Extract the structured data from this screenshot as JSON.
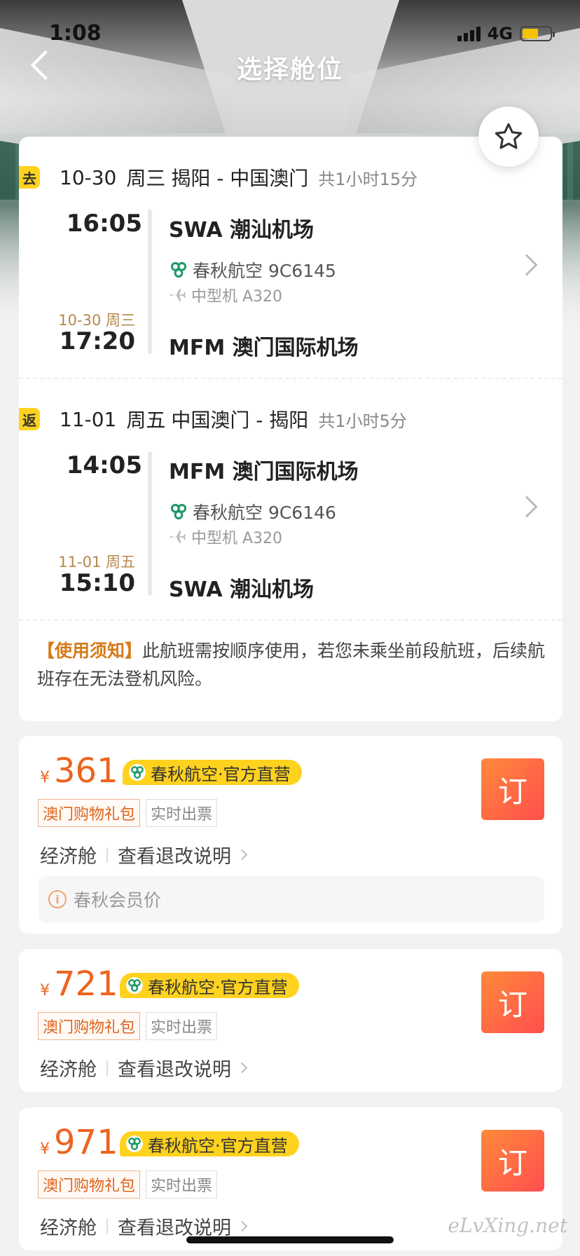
{
  "status_bar": {
    "time": "1:08",
    "network": "4G"
  },
  "nav": {
    "title": "选择舱位"
  },
  "segments": [
    {
      "tag": "去",
      "date": "10-30",
      "weekday": "周三",
      "route": "揭阳 - 中国澳门",
      "duration": "共1小时15分",
      "dep_time": "16:05",
      "dep_airport": "SWA 潮汕机场",
      "airline_flight": "春秋航空 9C6145",
      "aircraft": "中型机 A320",
      "arr_date": "10-30 周三",
      "arr_time": "17:20",
      "arr_airport": "MFM 澳门国际机场"
    },
    {
      "tag": "返",
      "date": "11-01",
      "weekday": "周五",
      "route": "中国澳门 - 揭阳",
      "duration": "共1小时5分",
      "dep_time": "14:05",
      "dep_airport": "MFM 澳门国际机场",
      "airline_flight": "春秋航空 9C6146",
      "aircraft": "中型机 A320",
      "arr_date": "11-01 周五",
      "arr_time": "15:10",
      "arr_airport": "SWA 潮汕机场"
    }
  ],
  "notice": {
    "highlight": "【使用须知】",
    "text": "此航班需按顺序使用，若您未乘坐前段航班，后续航班存在无法登机风险。"
  },
  "offers": [
    {
      "currency": "¥",
      "price": "361",
      "airline_badge": "春秋航空·官方直营",
      "tag1": "澳门购物礼包",
      "tag2": "实时出票",
      "cabin": "经济舱",
      "rules": "查看退改说明",
      "book": "订",
      "member": "春秋会员价"
    },
    {
      "currency": "¥",
      "price": "721",
      "airline_badge": "春秋航空·官方直营",
      "tag1": "澳门购物礼包",
      "tag2": "实时出票",
      "cabin": "经济舱",
      "rules": "查看退改说明",
      "book": "订"
    },
    {
      "currency": "¥",
      "price": "971",
      "airline_badge": "春秋航空·官方直营",
      "tag1": "澳门购物礼包",
      "tag2": "实时出票",
      "cabin": "经济舱",
      "rules": "查看退改说明",
      "book": "订"
    }
  ],
  "watermark": "eLvXing.net",
  "colors": {
    "accent_yellow": "#ffd21f",
    "price_orange": "#ee6420",
    "book_gradient_start": "#ff8a3a",
    "book_gradient_end": "#ff4e4e",
    "airline_green": "#1f9a6a"
  }
}
